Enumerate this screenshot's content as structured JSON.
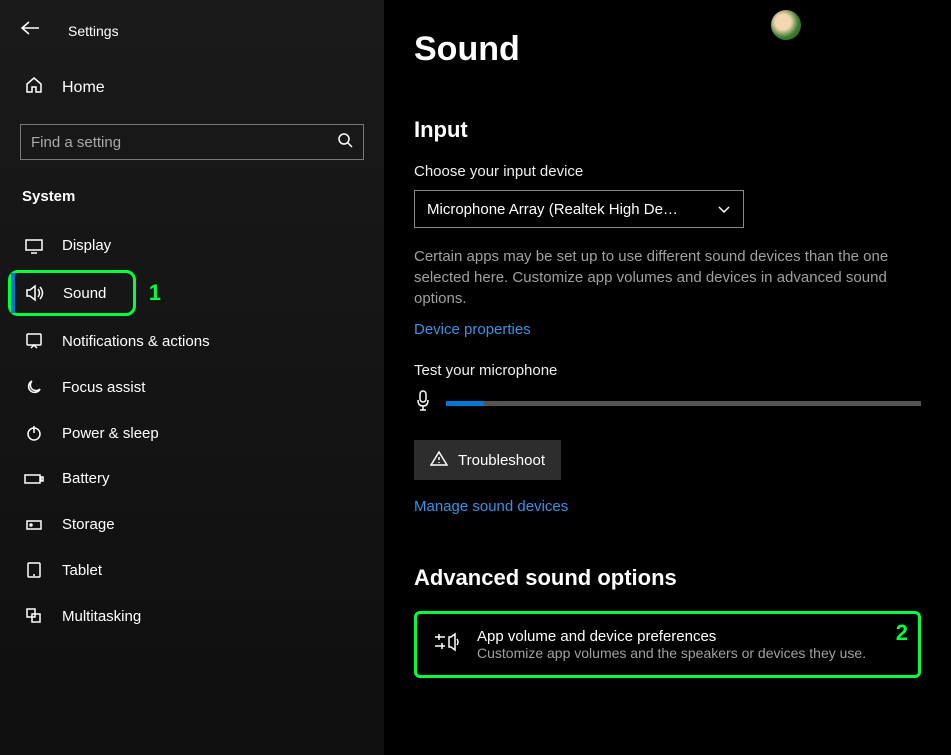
{
  "header": {
    "app_title": "Settings"
  },
  "sidebar": {
    "home_label": "Home",
    "search_placeholder": "Find a setting",
    "category": "System",
    "items": [
      {
        "label": "Display",
        "icon": "display-icon"
      },
      {
        "label": "Sound",
        "icon": "sound-icon",
        "selected": true,
        "annotation": "1"
      },
      {
        "label": "Notifications & actions",
        "icon": "notifications-icon"
      },
      {
        "label": "Focus assist",
        "icon": "focus-assist-icon"
      },
      {
        "label": "Power & sleep",
        "icon": "power-icon"
      },
      {
        "label": "Battery",
        "icon": "battery-icon"
      },
      {
        "label": "Storage",
        "icon": "storage-icon"
      },
      {
        "label": "Tablet",
        "icon": "tablet-icon"
      },
      {
        "label": "Multitasking",
        "icon": "multitasking-icon"
      }
    ]
  },
  "main": {
    "title": "Sound",
    "input_section": {
      "heading": "Input",
      "choose_label": "Choose your input device",
      "selected_device": "Microphone Array (Realtek High De…",
      "description": "Certain apps may be set up to use different sound devices than the one selected here. Customize app volumes and devices in advanced sound options.",
      "device_properties_link": "Device properties",
      "test_label": "Test your microphone",
      "troubleshoot_label": "Troubleshoot",
      "manage_link": "Manage sound devices"
    },
    "advanced_section": {
      "heading": "Advanced sound options",
      "item_title": "App volume and device preferences",
      "item_desc": "Customize app volumes and the speakers or devices they use.",
      "annotation": "2"
    }
  }
}
